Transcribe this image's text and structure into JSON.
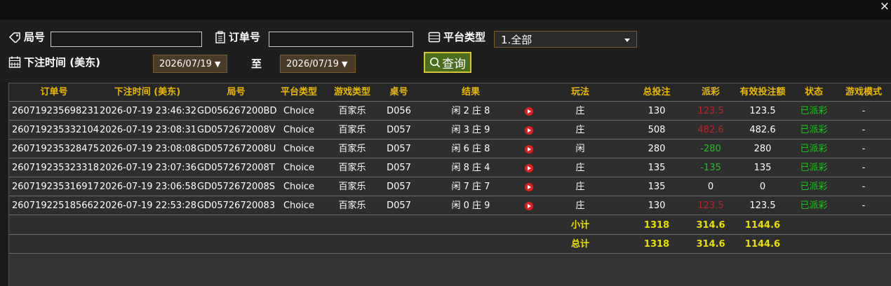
{
  "window": {
    "close_label": "×"
  },
  "filters": {
    "round_label": "局号",
    "round_value": "",
    "order_label": "订单号",
    "order_value": "",
    "platform_label": "平台类型",
    "platform_selected": "1.全部",
    "bettime_label": "下注时间 (美东)",
    "date_from": "2026/07/19",
    "to_label": "至",
    "date_to": "2026/07/19",
    "date_arrow": "▼",
    "query_label": "查询"
  },
  "table": {
    "headers": [
      "订单号",
      "下注时间 (美东)",
      "局号",
      "平台类型",
      "游戏类型",
      "桌号",
      "结果",
      "",
      "玩法",
      "总投注",
      "派彩",
      "有效投注额",
      "状态",
      "游戏模式"
    ],
    "rows": [
      [
        "260719235698231",
        "2026-07-19 23:46:32",
        "GD056267200BD",
        "Choice",
        "百家乐",
        "D056",
        "闲 2 庄 8",
        "",
        "庄",
        "130",
        "123.5",
        "123.5",
        "已派彩",
        "-"
      ],
      [
        "260719235332104",
        "2026-07-19 23:08:31",
        "GD0572672008V",
        "Choice",
        "百家乐",
        "D057",
        "闲 3 庄 9",
        "",
        "庄",
        "508",
        "482.6",
        "482.6",
        "已派彩",
        "-"
      ],
      [
        "260719235328475",
        "2026-07-19 23:08:08",
        "GD0572672008U",
        "Choice",
        "百家乐",
        "D057",
        "闲 6 庄 8",
        "",
        "闲",
        "280",
        "-280",
        "280",
        "已派彩",
        "-"
      ],
      [
        "260719235323318",
        "2026-07-19 23:07:36",
        "GD0572672008T",
        "Choice",
        "百家乐",
        "D057",
        "闲 8 庄 4",
        "",
        "庄",
        "135",
        "-135",
        "135",
        "已派彩",
        "-"
      ],
      [
        "260719235316917",
        "2026-07-19 23:06:58",
        "GD0572672008S",
        "Choice",
        "百家乐",
        "D057",
        "闲 7 庄 7",
        "",
        "庄",
        "135",
        "0",
        "0",
        "已派彩",
        "-"
      ],
      [
        "260719225185662",
        "2026-07-19 22:53:28",
        "GD05726720083",
        "Choice",
        "百家乐",
        "D057",
        "闲 0 庄 9",
        "",
        "庄",
        "130",
        "123.5",
        "123.5",
        "已派彩",
        "-"
      ]
    ],
    "payout_colors": [
      "red",
      "red",
      "green",
      "green",
      "white",
      "red"
    ],
    "subtotal": {
      "label": "小计",
      "total_bet": "1318",
      "payout": "314.6",
      "valid": "1144.6"
    },
    "total": {
      "label": "总计",
      "total_bet": "1318",
      "payout": "314.6",
      "valid": "1144.6"
    }
  },
  "colors": {
    "header_text": "#e8b800",
    "status_green": "#1ec21e",
    "loss_red": "#c0202a",
    "sum_yellow": "#e8e000"
  }
}
